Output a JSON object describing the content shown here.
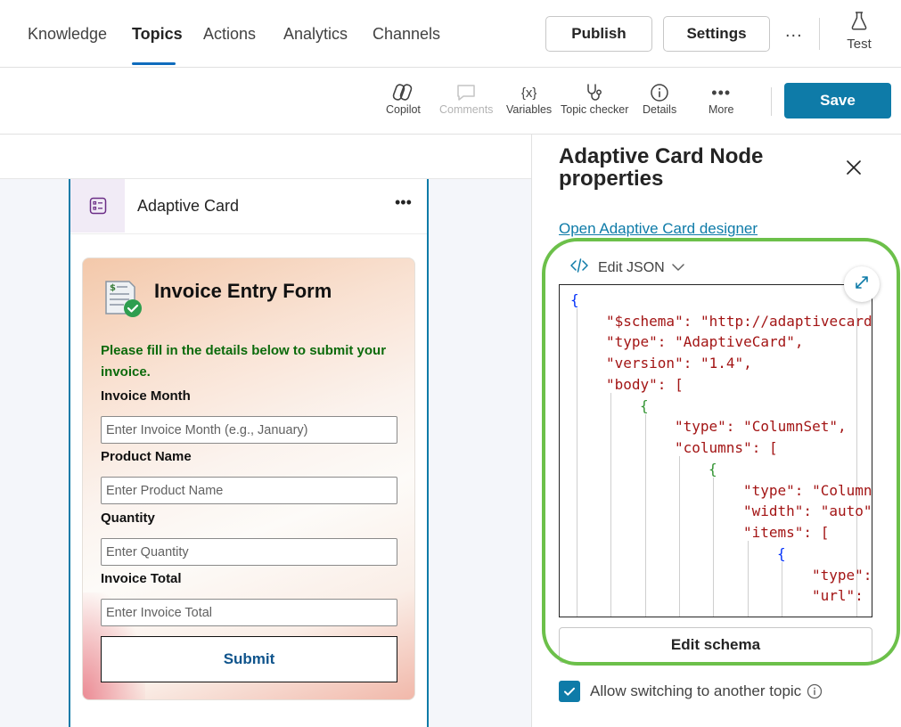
{
  "nav": {
    "tabs": [
      "Knowledge",
      "Topics",
      "Actions",
      "Analytics",
      "Channels"
    ],
    "active_tab": "Topics",
    "publish_label": "Publish",
    "settings_label": "Settings",
    "more_label": "...",
    "test_label": "Test"
  },
  "toolbar": {
    "copilot": "Copilot",
    "comments": "Comments",
    "variables": "Variables",
    "variables_glyph": "{x}",
    "topic_checker": "Topic checker",
    "details": "Details",
    "more": "More",
    "save_label": "Save"
  },
  "node": {
    "title": "Adaptive Card",
    "more": "...",
    "card": {
      "title": "Invoice Entry Form",
      "intro": "Please fill in the details below to submit your invoice.",
      "fields": [
        {
          "label": "Invoice Month",
          "placeholder": "Enter Invoice Month (e.g., January)"
        },
        {
          "label": "Product Name",
          "placeholder": "Enter Product Name"
        },
        {
          "label": "Quantity",
          "placeholder": "Enter Quantity"
        },
        {
          "label": "Invoice Total",
          "placeholder": "Enter Invoice Total"
        }
      ],
      "submit_label": "Submit"
    }
  },
  "panel": {
    "title": "Adaptive Card Node properties",
    "designer_link": "Open Adaptive Card designer",
    "edit_json_label": "Edit JSON",
    "code_lines": [
      "{",
      "\"$schema\": \"http://adaptivecard",
      "\"type\": \"AdaptiveCard\",",
      "\"version\": \"1.4\",",
      "\"body\": [",
      "{",
      "\"type\": \"ColumnSet\",",
      "\"columns\": [",
      "{",
      "\"type\": \"Column",
      "\"width\": \"auto\"",
      "\"items\": [",
      "{",
      "\"type\":",
      "\"url\":"
    ],
    "edit_schema_label": "Edit schema",
    "allow_switching_label": "Allow switching to another topic",
    "allow_switching_checked": true
  },
  "colors": {
    "accent": "#0e7ba8",
    "highlight": "#6cc04a",
    "intro_text": "#0b6a0b"
  }
}
